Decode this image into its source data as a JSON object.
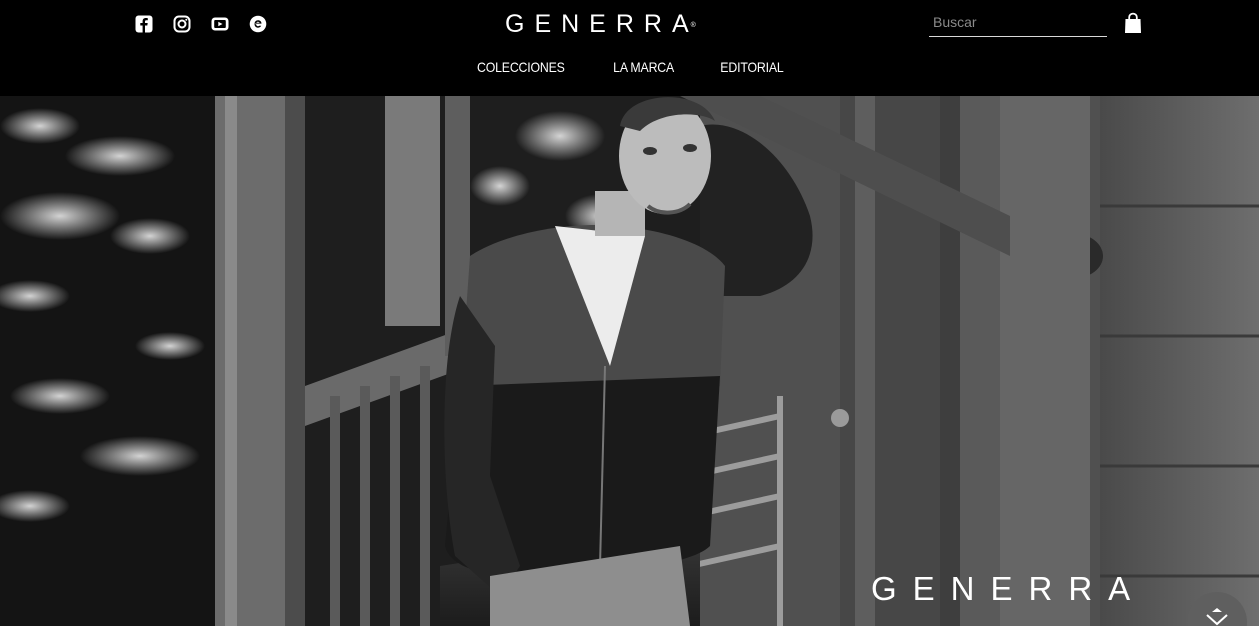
{
  "header": {
    "brand": "GENERRA",
    "brand_mark": "®",
    "social": [
      {
        "name": "facebook",
        "icon": "facebook-icon"
      },
      {
        "name": "instagram",
        "icon": "instagram-icon"
      },
      {
        "name": "youtube",
        "icon": "youtube-icon"
      },
      {
        "name": "blog",
        "icon": "blogger-icon"
      }
    ],
    "search": {
      "placeholder": "Buscar",
      "value": ""
    },
    "cart_icon": "shopping-bag-icon"
  },
  "nav": {
    "items": [
      "COLECCIONES",
      "LA MARCA",
      "EDITORIAL"
    ]
  },
  "hero": {
    "brand_overlay": "GENERRA",
    "scroll_icon": "chevron-down-icon"
  },
  "colors": {
    "header_bg": "#000000",
    "text": "#ffffff",
    "search_underline": "#d8d8d8",
    "scroll_button": "#5f5f5f"
  }
}
